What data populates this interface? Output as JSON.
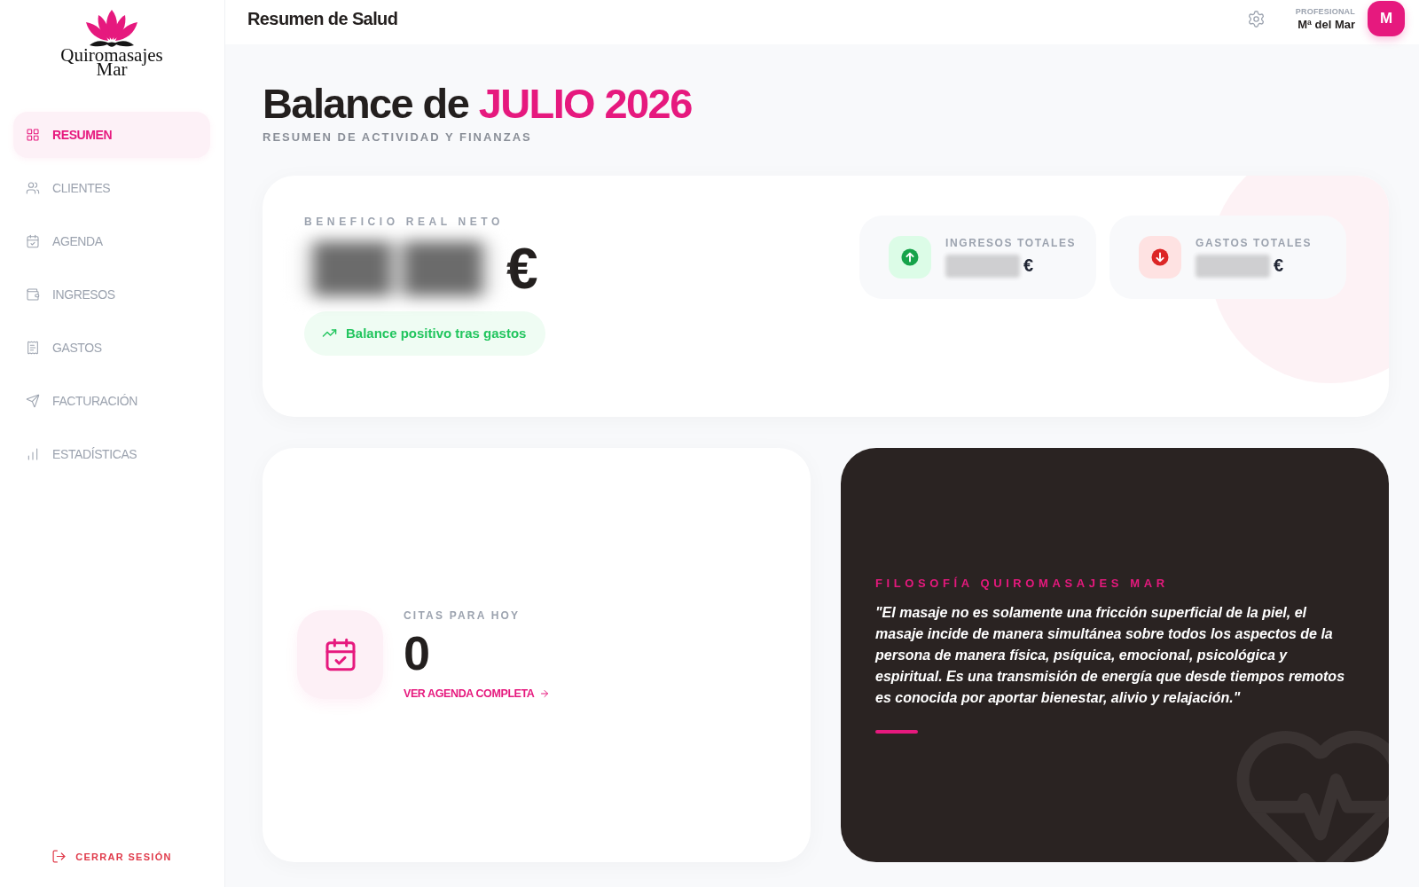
{
  "sidebar": {
    "logo_lines": [
      "Quiromasajes",
      "Mar"
    ],
    "items": [
      {
        "label": "RESUMEN",
        "selected": true
      },
      {
        "label": "CLIENTES",
        "selected": false
      },
      {
        "label": "AGENDA",
        "selected": false
      },
      {
        "label": "INGRESOS",
        "selected": false
      },
      {
        "label": "GASTOS",
        "selected": false
      },
      {
        "label": "FACTURACIÓN",
        "selected": false
      },
      {
        "label": "ESTADÍSTICAS",
        "selected": false
      }
    ],
    "logout": "CERRAR SESIÓN"
  },
  "header": {
    "title": "Resumen de Salud",
    "role": "PROFESIONAL",
    "user": "Mª del Mar",
    "avatar": "M"
  },
  "page": {
    "title": "Balance de",
    "period": "JULIO 2026",
    "subtitle": "RESUMEN DE ACTIVIDAD Y FINANZAS"
  },
  "balance": {
    "label": "BENEFICIO REAL NETO",
    "blurred": true,
    "currency": "€",
    "status": {
      "kind": "positive",
      "text": "Balance positivo tras gastos"
    },
    "totals": [
      {
        "kind": "income",
        "label": "INGRESOS TOTALES",
        "blurred": true,
        "currency": "€"
      },
      {
        "kind": "expense",
        "label": "GASTOS TOTALES",
        "blurred": true,
        "currency": "€"
      }
    ]
  },
  "appointments": {
    "label": "CITAS PARA HOY",
    "count": "0",
    "link": "VER AGENDA COMPLETA"
  },
  "philosophy": {
    "title": "FILOSOFÍA QUIROMASAJES MAR",
    "quote": "\"El masaje no es solamente una fricción superficial de la piel, el masaje incide de manera simultánea sobre todos los aspectos de la persona de manera física, psíquica, emocional, psicológica y espiritual. Es una transmisión de energía que desde tiempos remotos es conocida por aportar bienestar, alivio y relajación.\""
  }
}
